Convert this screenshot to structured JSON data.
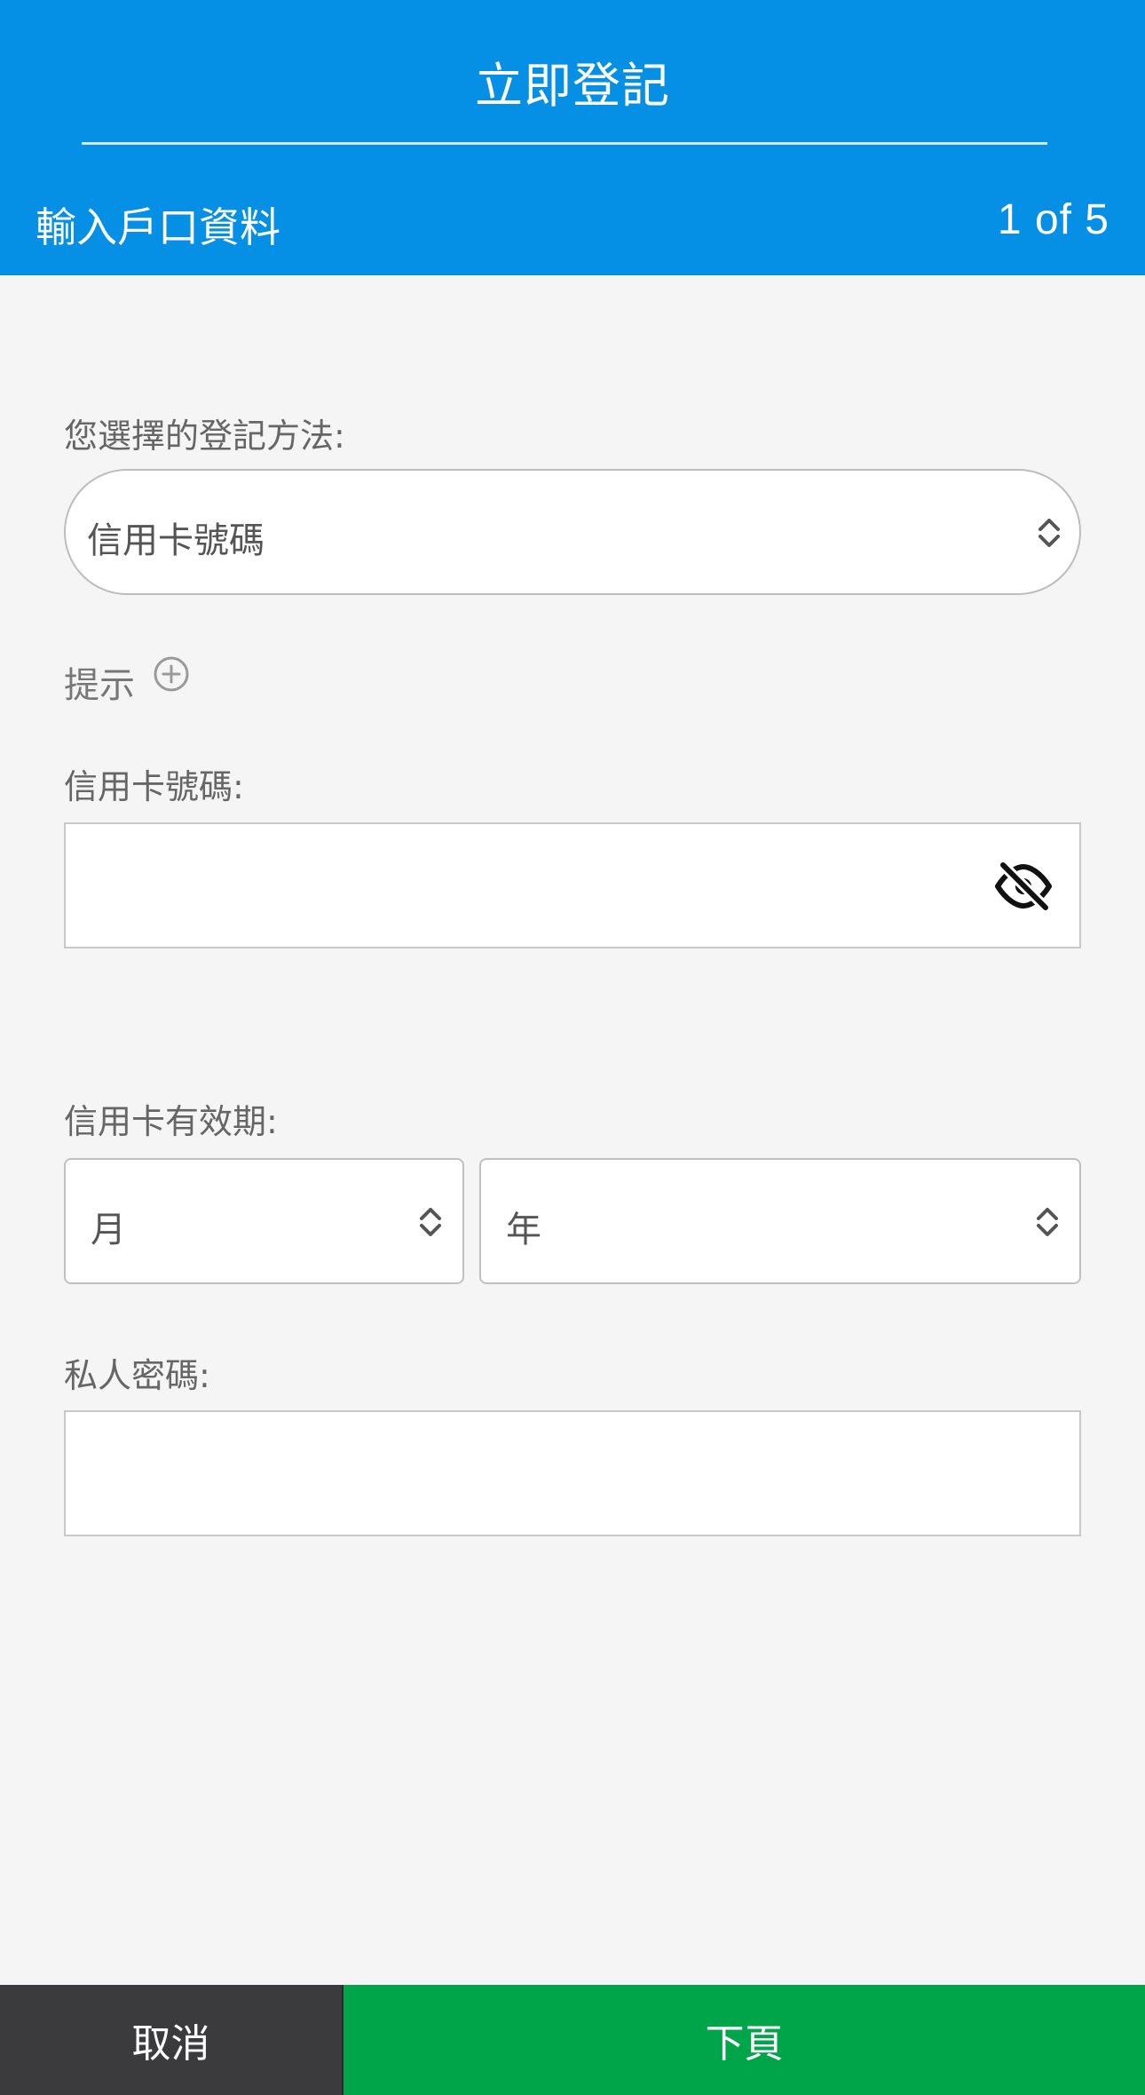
{
  "header": {
    "title": "立即登記",
    "step_label": "輸入戶口資料",
    "progress": "1 of 5"
  },
  "form": {
    "method_label": "您選擇的登記方法:",
    "method_value": "信用卡號碼",
    "hint_label": "提示",
    "card_number_label": "信用卡號碼:",
    "card_number_value": "",
    "expiry_label": "信用卡有效期:",
    "expiry_month_value": "月",
    "expiry_year_value": "年",
    "pin_label": "私人密碼:",
    "pin_value": ""
  },
  "footer": {
    "cancel_label": "取消",
    "next_label": "下頁"
  },
  "colors": {
    "header_blue": "#0590e6",
    "next_green": "#00a54a",
    "cancel_dark": "#3b3b3d"
  },
  "icons": {
    "hint": "plus-circle-icon",
    "visibility": "eye-off-icon",
    "select": "chevron-up-down-icon"
  }
}
